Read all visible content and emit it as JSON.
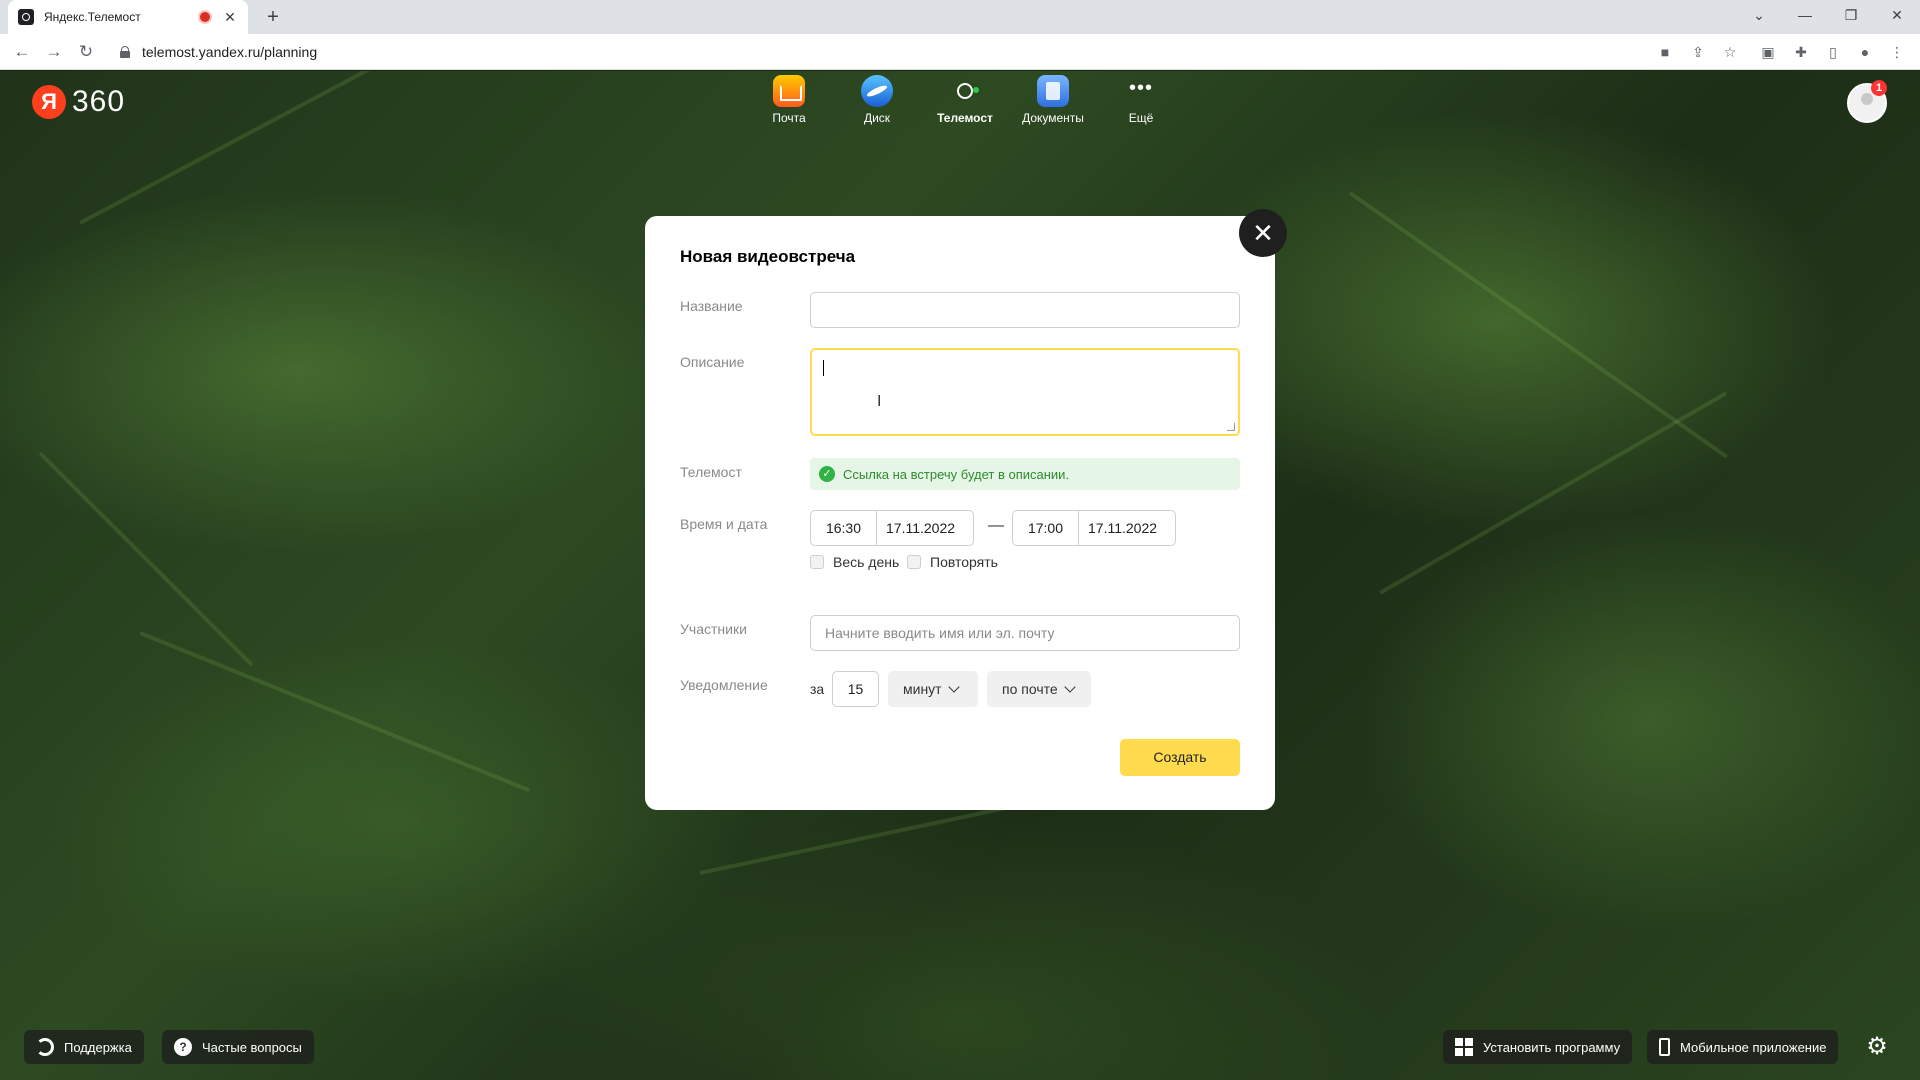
{
  "browser": {
    "tab_title": "Яндекс.Телемост",
    "tab_close": "✕",
    "new_tab": "+",
    "url": "telemost.yandex.ru/planning"
  },
  "header": {
    "logo_letter": "Я",
    "logo_text": "360",
    "services": [
      {
        "label": "Почта",
        "icon": "mail-icon"
      },
      {
        "label": "Диск",
        "icon": "disk-icon"
      },
      {
        "label": "Телемост",
        "icon": "telemost-icon",
        "active": true
      },
      {
        "label": "Документы",
        "icon": "documents-icon"
      },
      {
        "label": "Ещё",
        "icon": "more-icon"
      }
    ],
    "notifications_count": "1"
  },
  "modal": {
    "title": "Новая видеовстреча",
    "close": "✕",
    "name_label": "Название",
    "name_value": "",
    "description_label": "Описание",
    "description_value": "",
    "telemost_label": "Телемост",
    "telemost_notice": "Ссылка на встречу будет в описании.",
    "datetime_label": "Время и дата",
    "start_time": "16:30",
    "start_date": "17.11.2022",
    "dash": "—",
    "end_time": "17:00",
    "end_date": "17.11.2022",
    "all_day_label": "Весь день",
    "all_day_checked": false,
    "repeat_label": "Повторять",
    "repeat_checked": false,
    "participants_label": "Участники",
    "participants_placeholder": "Начните вводить имя или эл. почту",
    "notification_label": "Уведомление",
    "notification_prefix": "за",
    "notification_value": "15",
    "notification_unit": "минут",
    "notification_channel": "по почте",
    "create_button": "Создать"
  },
  "footer": {
    "support": "Поддержка",
    "faq": "Частые вопросы",
    "faq_icon_glyph": "?",
    "install": "Установить программу",
    "mobile": "Мобильное приложение"
  }
}
